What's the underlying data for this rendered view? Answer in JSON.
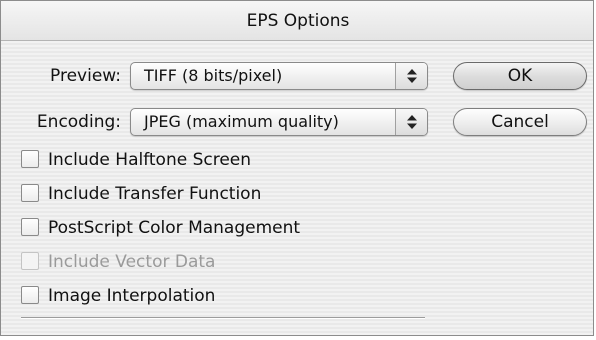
{
  "dialog": {
    "title": "EPS Options"
  },
  "preview": {
    "label": "Preview:",
    "value": "TIFF  (8 bits/pixel)"
  },
  "encoding": {
    "label": "Encoding:",
    "value": "JPEG  (maximum quality)"
  },
  "buttons": {
    "ok_label": "OK",
    "cancel_label": "Cancel"
  },
  "options": [
    {
      "label": "Include Halftone Screen",
      "checked": false,
      "enabled": true
    },
    {
      "label": "Include Transfer Function",
      "checked": false,
      "enabled": true
    },
    {
      "label": "PostScript Color Management",
      "checked": false,
      "enabled": true
    },
    {
      "label": "Include Vector Data",
      "checked": false,
      "enabled": false
    },
    {
      "label": "Image Interpolation",
      "checked": false,
      "enabled": true
    }
  ],
  "icons": {
    "popup_arrows": "up-down-arrows-icon"
  }
}
